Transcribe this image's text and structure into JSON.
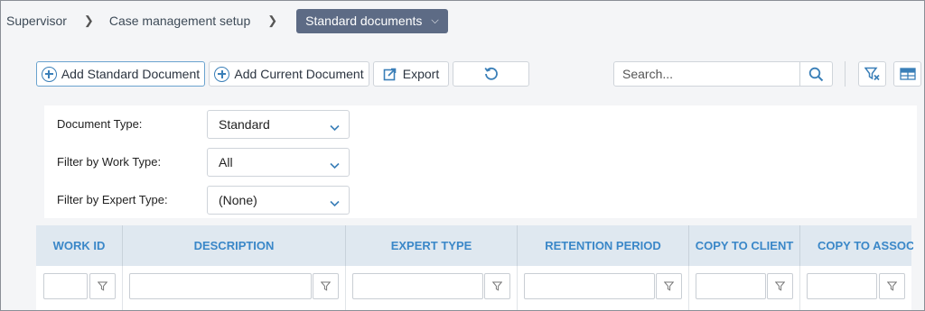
{
  "breadcrumb": {
    "items": [
      "Supervisor",
      "Case management setup"
    ],
    "current": "Standard documents"
  },
  "toolbar": {
    "add_standard_label": "Add Standard Document",
    "add_current_label": "Add Current Document",
    "export_label": "Export",
    "search_placeholder": "Search..."
  },
  "filters": {
    "document_type": {
      "label": "Document Type:",
      "value": "Standard"
    },
    "work_type": {
      "label": "Filter by Work Type:",
      "value": "All"
    },
    "expert_type": {
      "label": "Filter by Expert Type:",
      "value": "(None)"
    }
  },
  "grid": {
    "columns": [
      "WORK ID",
      "DESCRIPTION",
      "EXPERT TYPE",
      "RETENTION PERIOD",
      "COPY TO CLIENT",
      "COPY TO ASSOCI"
    ]
  },
  "colors": {
    "accent": "#3a87c8",
    "breadcrumb_active": "#5d6b85",
    "header_bg": "#dfe8f0",
    "page_bg": "#f4f5f7"
  },
  "icons": [
    "chevron-right-icon",
    "chevron-down-icon",
    "plus-circle-icon",
    "export-icon",
    "refresh-icon",
    "search-icon",
    "clear-filter-icon",
    "columns-icon",
    "filter-icon"
  ]
}
